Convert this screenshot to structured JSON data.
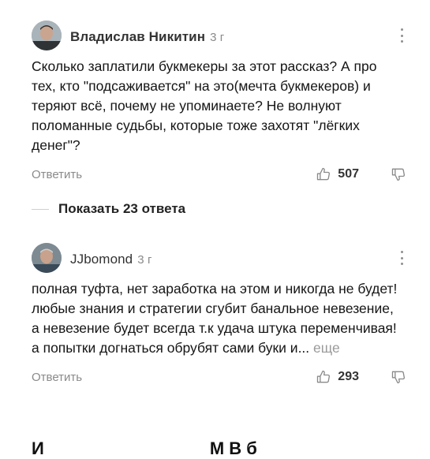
{
  "comments": [
    {
      "author": "Владислав Никитин",
      "time": "3 г",
      "text": "Сколько заплатили букмекеры за этот рассказ? А про тех, кто \"подсаживается\" на это(мечта букмекеров) и теряют всё, почему не упоминаете? Не волнуют поломанные судьбы, которые тоже захотят \"лёгких денег\"?",
      "reply_label": "Ответить",
      "likes": "507",
      "avatar_icon": "user-photo-avatar",
      "icons": [
        "more-vertical-icon",
        "thumbs-up-icon",
        "thumbs-down-icon"
      ]
    },
    {
      "author": "JJbomond",
      "time": "3 г",
      "text": "полная туфта, нет заработка на этом и никогда не будет! любые знания и стратегии сгубит банальное невезение, а невезение будет всегда т.к удача штука переменчивая! а попытки догнаться обрубят сами буки и...",
      "more_label": "еще",
      "reply_label": "Ответить",
      "likes": "293",
      "avatar_icon": "user-photo-avatar",
      "icons": [
        "more-vertical-icon",
        "thumbs-up-icon",
        "thumbs-down-icon"
      ]
    }
  ],
  "show_replies": "Показать 23 ответа",
  "bottom_partial_text_left": "И",
  "bottom_partial_text_right": "М   В   б",
  "colors": {
    "text": "#151515",
    "muted": "#8a8a8a",
    "bg": "#ffffff"
  }
}
